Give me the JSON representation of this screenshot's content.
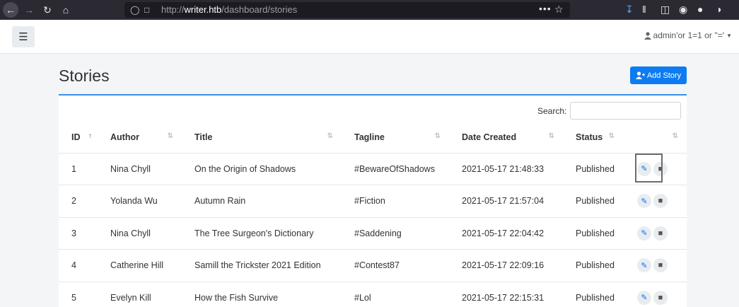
{
  "browser": {
    "url": "http://writer.htb/dashboard/stories",
    "url_protocol": "http://",
    "url_host": "writer.htb",
    "url_path": "/dashboard/stories",
    "more_glyph": "•••",
    "icons": [
      "back-icon",
      "forward-icon",
      "reload-icon",
      "home-icon",
      "shield-icon",
      "lock-icon",
      "star-icon",
      "download-icon",
      "library-icon",
      "sidebar-icon",
      "extension-icon",
      "menu-icon"
    ]
  },
  "topnav": {
    "menu_glyph": "☰",
    "user_label": "admin'or 1=1 or ''='"
  },
  "page": {
    "title": "Stories",
    "add_story_label": "Add Story",
    "search_label": "Search:",
    "search_value": ""
  },
  "table": {
    "columns": [
      "ID",
      "Author",
      "Title",
      "Tagline",
      "Date Created",
      "Status",
      ""
    ],
    "rows": [
      {
        "id": "1",
        "author": "Nina Chyll",
        "title": "On the Origin of Shadows",
        "tagline": "#BewareOfShadows",
        "date": "2021-05-17 21:48:33",
        "status": "Published"
      },
      {
        "id": "2",
        "author": "Yolanda Wu",
        "title": "Autumn Rain",
        "tagline": "#Fiction",
        "date": "2021-05-17 21:57:04",
        "status": "Published"
      },
      {
        "id": "3",
        "author": "Nina Chyll",
        "title": "The Tree Surgeon's Dictionary",
        "tagline": "#Saddening",
        "date": "2021-05-17 22:04:42",
        "status": "Published"
      },
      {
        "id": "4",
        "author": "Catherine Hill",
        "title": "Samill the Trickster 2021 Edition",
        "tagline": "#Contest87",
        "date": "2021-05-17 22:09:16",
        "status": "Published"
      },
      {
        "id": "5",
        "author": "Evelyn Kill",
        "title": "How the Fish Survive",
        "tagline": "#Lol",
        "date": "2021-05-17 22:15:31",
        "status": "Published"
      }
    ]
  },
  "colors": {
    "accent": "#0d7bf2",
    "browser_bg": "#2b2a33"
  }
}
